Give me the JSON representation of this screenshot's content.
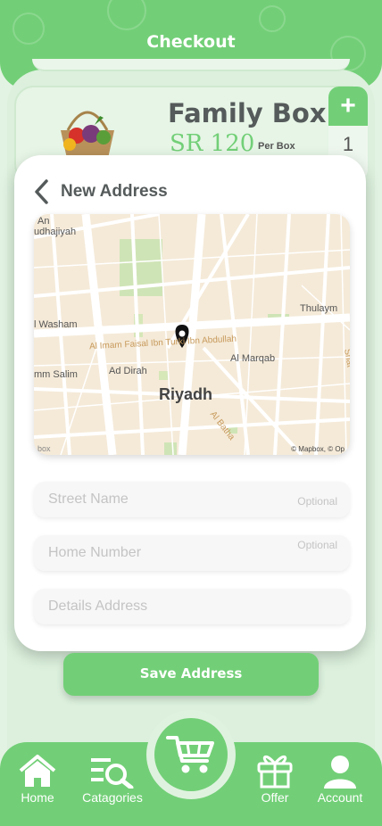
{
  "header": {
    "title": "Checkout"
  },
  "product": {
    "name": "Family Box",
    "price": "SR 120",
    "unit": "Per Box",
    "quantity": "1",
    "plus_label": "+"
  },
  "modal": {
    "title": "New Address",
    "map": {
      "labels": {
        "an": "An",
        "sudhajiyah": "udhajiyah",
        "washam": "l Washam",
        "thulaym": "Thulaym",
        "road": "Al Imam Faisal Ibn Turki Ibn Abdullah",
        "salim": "mm Salim",
        "ad_dirah": "Ad Dirah",
        "al_marqab": "Al Marqab",
        "riyadh": "Riyadh",
        "al_batha": "Al Batha",
        "shat": "Shat"
      },
      "attribution": "© Mapbox, © Op",
      "logo": "box"
    },
    "fields": {
      "street": {
        "placeholder": "Street Name",
        "optional": "Optional"
      },
      "home": {
        "placeholder": "Home Number",
        "optional": "Optional"
      },
      "details": {
        "placeholder": "Details Address"
      }
    },
    "save_label": "Save Address"
  },
  "nav": {
    "home": "Home",
    "categories": "Catagories",
    "offer": "Offer",
    "account": "Account"
  },
  "colors": {
    "accent": "#72cf77",
    "background": "#e3f3e3"
  }
}
